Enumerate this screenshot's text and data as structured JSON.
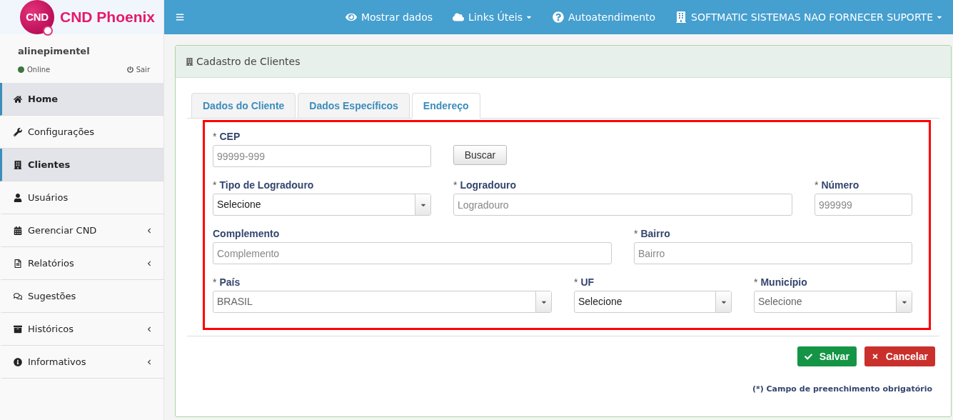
{
  "logo": {
    "badge": "CND",
    "name": "CND Phoenix"
  },
  "user": {
    "name": "alinepimentel",
    "status": {
      "label": "Online",
      "color": "#3c763d"
    },
    "logout": "Sair"
  },
  "sidebar": {
    "items": [
      {
        "label": "Home",
        "selected": true,
        "expandable": false
      },
      {
        "label": "Configurações",
        "selected": false,
        "expandable": false
      },
      {
        "label": "Clientes",
        "selected": true,
        "expandable": false
      },
      {
        "label": "Usuários",
        "selected": false,
        "expandable": false
      },
      {
        "label": "Gerenciar CND",
        "selected": false,
        "expandable": true
      },
      {
        "label": "Relatórios",
        "selected": false,
        "expandable": true
      },
      {
        "label": "Sugestões",
        "selected": false,
        "expandable": false
      },
      {
        "label": "Históricos",
        "selected": false,
        "expandable": true
      },
      {
        "label": "Informativos",
        "selected": false,
        "expandable": true
      }
    ]
  },
  "topbar": {
    "items": [
      {
        "label": "Mostrar dados",
        "dropdown": false
      },
      {
        "label": "Links Úteis",
        "dropdown": true
      },
      {
        "label": "Autoatendimento",
        "dropdown": false
      },
      {
        "label": "SOFTMATIC SISTEMAS NAO FORNECER SUPORTE",
        "dropdown": true
      }
    ]
  },
  "panel": {
    "title": "Cadastro de Clientes",
    "tabs": [
      {
        "label": "Dados do Cliente",
        "selected": false
      },
      {
        "label": "Dados Específicos",
        "selected": false
      },
      {
        "label": "Endereço",
        "selected": true
      }
    ],
    "form_rows": [
      [
        {
          "kind": "text",
          "label": "CEP",
          "required": true,
          "placeholder": "99999-999"
        },
        {
          "kind": "button",
          "text": "Buscar"
        }
      ],
      [
        {
          "kind": "select",
          "label": "Tipo de Logradouro",
          "required": true,
          "value": "Selecione",
          "disabled": false
        },
        {
          "kind": "text",
          "label": "Logradouro",
          "required": true,
          "placeholder": "Logradouro"
        },
        {
          "kind": "text",
          "label": "Número",
          "required": true,
          "placeholder": "999999"
        }
      ],
      [
        {
          "kind": "text",
          "label": "Complemento",
          "required": false,
          "placeholder": "Complemento"
        },
        {
          "kind": "text",
          "label": "Bairro",
          "required": true,
          "placeholder": "Bairro"
        }
      ],
      [
        {
          "kind": "select",
          "label": "País",
          "required": true,
          "value": "BRASIL",
          "disabled": true
        },
        {
          "kind": "select",
          "label": "UF",
          "required": true,
          "value": "Selecione",
          "disabled": false
        },
        {
          "kind": "select",
          "label": "Município",
          "required": true,
          "value": "Selecione",
          "disabled": true
        }
      ]
    ],
    "required_mark": "*",
    "actions": [
      {
        "kind": "save",
        "label": "Salvar"
      },
      {
        "kind": "cancel",
        "label": "Cancelar"
      }
    ],
    "note": "(*) Campo de preenchimento obrigatório"
  }
}
